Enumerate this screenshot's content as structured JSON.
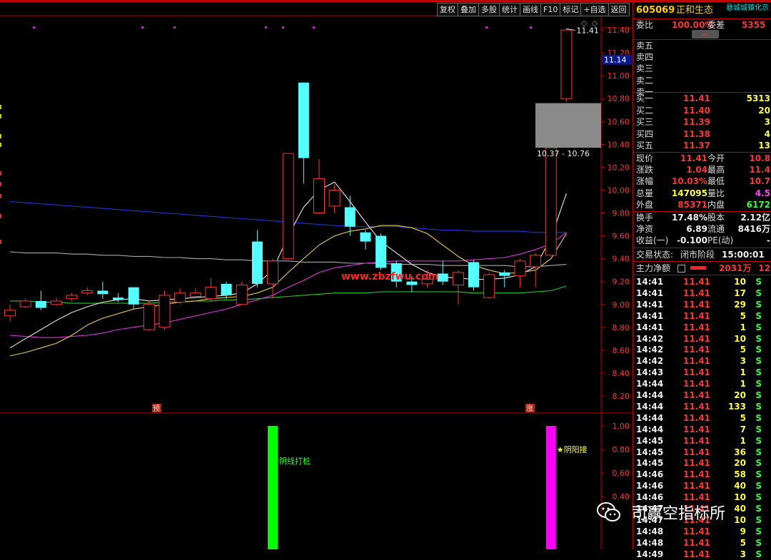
{
  "toolbar": [
    "复权",
    "叠加",
    "多股",
    "统计",
    "画线",
    "F10",
    "标记",
    "+自选",
    "返回"
  ],
  "price_axis": [
    "11.40",
    "11.20",
    "11.00",
    "10.80",
    "10.60",
    "10.40",
    "10.20",
    "10.00",
    "9.80",
    "9.60",
    "9.40",
    "9.20",
    "9.00",
    "8.80",
    "8.60",
    "8.40",
    "8.20"
  ],
  "price_scale_min": 8.2,
  "price_scale_max": 11.4,
  "indicator_axis": [
    "1.00",
    "0.80",
    "0.60",
    "0.40"
  ],
  "current_price_tag": "11.14",
  "chart": {
    "high_label": "11.41",
    "range_label": "10.37 - 10.76",
    "site_watermark": "www.zbzfwu.com",
    "marker_left": "预",
    "marker_right": "涨",
    "signal_green": "阴线打桩",
    "signal_magenta": "★阴阳接"
  },
  "chart_data": {
    "type": "candlestick",
    "candles": [
      {
        "o": 8.9,
        "c": 8.95,
        "h": 9.0,
        "l": 8.85
      },
      {
        "o": 8.98,
        "c": 9.03,
        "h": 9.05,
        "l": 8.97
      },
      {
        "o": 9.03,
        "c": 8.97,
        "h": 9.12,
        "l": 8.95
      },
      {
        "o": 9.0,
        "c": 9.03,
        "h": 9.06,
        "l": 8.99
      },
      {
        "o": 9.05,
        "c": 9.08,
        "h": 9.1,
        "l": 9.03
      },
      {
        "o": 9.1,
        "c": 9.12,
        "h": 9.15,
        "l": 9.08
      },
      {
        "o": 9.12,
        "c": 9.09,
        "h": 9.2,
        "l": 9.05
      },
      {
        "o": 9.06,
        "c": 9.04,
        "h": 9.1,
        "l": 9.02
      },
      {
        "o": 9.15,
        "c": 9.0,
        "h": 9.15,
        "l": 8.96
      },
      {
        "o": 8.78,
        "c": 9.0,
        "h": 9.03,
        "l": 8.77
      },
      {
        "o": 8.8,
        "c": 9.08,
        "h": 9.12,
        "l": 8.78
      },
      {
        "o": 9.02,
        "c": 9.1,
        "h": 9.14,
        "l": 9.0
      },
      {
        "o": 9.07,
        "c": 9.1,
        "h": 9.14,
        "l": 9.05
      },
      {
        "o": 9.05,
        "c": 9.15,
        "h": 9.23,
        "l": 9.03
      },
      {
        "o": 9.18,
        "c": 9.08,
        "h": 9.2,
        "l": 9.05
      },
      {
        "o": 9.0,
        "c": 9.17,
        "h": 9.2,
        "l": 9.0
      },
      {
        "o": 9.55,
        "c": 9.18,
        "h": 9.65,
        "l": 9.15
      },
      {
        "o": 9.18,
        "c": 9.38,
        "h": 9.4,
        "l": 9.05
      },
      {
        "o": 9.4,
        "c": 10.32,
        "h": 10.32,
        "l": 9.4
      },
      {
        "o": 10.94,
        "c": 10.28,
        "h": 10.94,
        "l": 10.06
      },
      {
        "o": 9.8,
        "c": 10.1,
        "h": 10.27,
        "l": 9.79
      },
      {
        "o": 9.86,
        "c": 10.0,
        "h": 10.05,
        "l": 9.8
      },
      {
        "o": 9.85,
        "c": 9.68,
        "h": 9.95,
        "l": 9.6
      },
      {
        "o": 9.63,
        "c": 9.55,
        "h": 9.65,
        "l": 9.48
      },
      {
        "o": 9.6,
        "c": 9.32,
        "h": 9.62,
        "l": 9.3
      },
      {
        "o": 9.36,
        "c": 9.2,
        "h": 9.38,
        "l": 9.15
      },
      {
        "o": 9.2,
        "c": 9.17,
        "h": 9.25,
        "l": 9.11
      },
      {
        "o": 9.18,
        "c": 9.22,
        "h": 9.3,
        "l": 9.15
      },
      {
        "o": 9.27,
        "c": 9.2,
        "h": 9.38,
        "l": 9.17
      },
      {
        "o": 9.17,
        "c": 9.28,
        "h": 9.3,
        "l": 9.0
      },
      {
        "o": 9.37,
        "c": 9.15,
        "h": 9.39,
        "l": 9.12
      },
      {
        "o": 9.06,
        "c": 9.26,
        "h": 9.28,
        "l": 9.05
      },
      {
        "o": 9.28,
        "c": 9.25,
        "h": 9.3,
        "l": 9.15
      },
      {
        "o": 9.25,
        "c": 9.38,
        "h": 9.4,
        "l": 9.15
      },
      {
        "o": 9.33,
        "c": 9.43,
        "h": 9.45,
        "l": 9.15
      },
      {
        "o": 9.43,
        "c": 10.37,
        "h": 10.37,
        "l": 9.43
      },
      {
        "o": 10.8,
        "c": 11.4,
        "h": 11.41,
        "l": 10.77
      }
    ],
    "ma_white": [
      8.62,
      8.7,
      8.78,
      8.86,
      8.93,
      8.98,
      9.02,
      9.04,
      9.05,
      9.03,
      9.04,
      9.05,
      9.06,
      9.07,
      9.08,
      9.1,
      9.18,
      9.3,
      9.6,
      9.85,
      10.0,
      10.07,
      9.9,
      9.72,
      9.55,
      9.45,
      9.35,
      9.28,
      9.24,
      9.23,
      9.22,
      9.22,
      9.23,
      9.26,
      9.33,
      9.58,
      9.97
    ],
    "ma_yellow": [
      8.55,
      8.58,
      8.62,
      8.66,
      8.73,
      8.82,
      8.88,
      8.92,
      8.96,
      8.98,
      9.0,
      9.02,
      9.03,
      9.05,
      9.06,
      9.07,
      9.1,
      9.15,
      9.28,
      9.4,
      9.52,
      9.6,
      9.64,
      9.66,
      9.69,
      9.69,
      9.67,
      9.62,
      9.52,
      9.42,
      9.34,
      9.3,
      9.27,
      9.28,
      9.3,
      9.4,
      9.62
    ],
    "ma_magenta": [
      8.73,
      8.72,
      8.71,
      8.71,
      8.72,
      8.73,
      8.75,
      8.78,
      8.8,
      8.82,
      8.84,
      8.87,
      8.9,
      8.93,
      8.96,
      9.0,
      9.04,
      9.08,
      9.15,
      9.21,
      9.28,
      9.32,
      9.34,
      9.36,
      9.37,
      9.38,
      9.38,
      9.38,
      9.38,
      9.38,
      9.39,
      9.4,
      9.41,
      9.44,
      9.48,
      9.53,
      9.63
    ],
    "ma_green": [
      9.03,
      9.03,
      9.02,
      9.02,
      9.01,
      9.01,
      9.01,
      9.01,
      9.01,
      9.01,
      9.02,
      9.02,
      9.03,
      9.03,
      9.04,
      9.04,
      9.05,
      9.06,
      9.07,
      9.08,
      9.09,
      9.1,
      9.1,
      9.1,
      9.11,
      9.11,
      9.11,
      9.11,
      9.11,
      9.11,
      9.1,
      9.1,
      9.1,
      9.1,
      9.11,
      9.12,
      9.16
    ],
    "ma_blue": [
      9.9,
      9.89,
      9.88,
      9.87,
      9.86,
      9.85,
      9.84,
      9.83,
      9.82,
      9.81,
      9.8,
      9.79,
      9.78,
      9.77,
      9.76,
      9.75,
      9.74,
      9.73,
      9.72,
      9.71,
      9.7,
      9.69,
      9.68,
      9.68,
      9.68,
      9.68,
      9.67,
      9.66,
      9.65,
      9.65,
      9.64,
      9.64,
      9.64,
      9.64,
      9.63,
      9.63,
      9.63
    ],
    "ma_gray": [
      9.46,
      9.45,
      9.45,
      9.45,
      9.44,
      9.44,
      9.43,
      9.43,
      9.42,
      9.42,
      9.41,
      9.41,
      9.4,
      9.4,
      9.39,
      9.39,
      9.38,
      9.38,
      9.38,
      9.37,
      9.37,
      9.37,
      9.36,
      9.36,
      9.36,
      9.35,
      9.35,
      9.35,
      9.34,
      9.34,
      9.34,
      9.34,
      9.34,
      9.33,
      9.33,
      9.34,
      9.35
    ],
    "signals": [
      {
        "index": 17,
        "color": "#00ff00",
        "value": 1.0
      },
      {
        "index": 35,
        "color": "#ff00ff",
        "value": 1.0
      }
    ]
  },
  "quote": {
    "code": "605069",
    "name": "正和生态",
    "ticker_scroll": "悬城城镇化示",
    "weibi_label": "委比",
    "weibi_value": "100.00%",
    "weicha_label": "委差",
    "weicha_value": "5355",
    "sells": [
      {
        "label": "卖五"
      },
      {
        "label": "卖四"
      },
      {
        "label": "卖三"
      },
      {
        "label": "卖二"
      },
      {
        "label": "卖一"
      }
    ],
    "buys": [
      {
        "label": "买一",
        "price": "11.41",
        "vol": "5313"
      },
      {
        "label": "买二",
        "price": "11.40",
        "vol": "20"
      },
      {
        "label": "买三",
        "price": "11.39",
        "vol": "3"
      },
      {
        "label": "买四",
        "price": "11.38",
        "vol": "4"
      },
      {
        "label": "买五",
        "price": "11.37",
        "vol": "13"
      }
    ],
    "stats": [
      {
        "l1": "现价",
        "v1": "11.41",
        "c1": "red",
        "l2": "今开",
        "v2": "10.8",
        "c2": "red"
      },
      {
        "l1": "涨跌",
        "v1": "1.04",
        "c1": "red",
        "l2": "最高",
        "v2": "11.4",
        "c2": "red"
      },
      {
        "l1": "涨幅",
        "v1": "10.03%",
        "c1": "red",
        "l2": "最低",
        "v2": "10.7",
        "c2": "red"
      },
      {
        "l1": "总量",
        "v1": "147095",
        "c1": "yel",
        "l2": "量比",
        "v2": "4.5",
        "c2": "mag"
      },
      {
        "l1": "外盘",
        "v1": "85371",
        "c1": "red",
        "l2": "内盘",
        "v2": "6172",
        "c2": "grn"
      }
    ],
    "stats2": [
      {
        "l1": "换手",
        "v1": "17.48%",
        "l2": "股本",
        "v2": "2.12亿"
      },
      {
        "l1": "净资",
        "v1": "6.89",
        "l2": "流通",
        "v2": "8416万"
      },
      {
        "l1": "收益(一)",
        "v1": "-0.100",
        "l2": "PE(动)",
        "v2": "-"
      }
    ],
    "trade_state_label": "交易状态:",
    "trade_state_value": "闭市阶段",
    "trade_time": "15:00:01",
    "net_label": "主力净额",
    "net_value": "2031万",
    "net_extra": "12"
  },
  "ticks": [
    {
      "t": "14:41",
      "p": "11.41",
      "v": "10",
      "s": "S"
    },
    {
      "t": "14:41",
      "p": "11.41",
      "v": "17",
      "s": "S"
    },
    {
      "t": "14:41",
      "p": "11.41",
      "v": "29",
      "s": "S"
    },
    {
      "t": "14:41",
      "p": "11.41",
      "v": "5",
      "s": "S"
    },
    {
      "t": "14:41",
      "p": "11.41",
      "v": "1",
      "s": "S"
    },
    {
      "t": "14:42",
      "p": "11.41",
      "v": "10",
      "s": "S"
    },
    {
      "t": "14:42",
      "p": "11.41",
      "v": "5",
      "s": "S"
    },
    {
      "t": "14:42",
      "p": "11.41",
      "v": "3",
      "s": "S"
    },
    {
      "t": "14:43",
      "p": "11.41",
      "v": "1",
      "s": "S"
    },
    {
      "t": "14:44",
      "p": "11.41",
      "v": "1",
      "s": "S"
    },
    {
      "t": "14:44",
      "p": "11.41",
      "v": "20",
      "s": "S"
    },
    {
      "t": "14:44",
      "p": "11.41",
      "v": "133",
      "s": "S"
    },
    {
      "t": "14:44",
      "p": "11.41",
      "v": "5",
      "s": "S"
    },
    {
      "t": "14:44",
      "p": "11.41",
      "v": "7",
      "s": "S"
    },
    {
      "t": "14:45",
      "p": "11.41",
      "v": "1",
      "s": "S"
    },
    {
      "t": "14:45",
      "p": "11.41",
      "v": "36",
      "s": "S"
    },
    {
      "t": "14:45",
      "p": "11.41",
      "v": "20",
      "s": "S"
    },
    {
      "t": "14:46",
      "p": "11.41",
      "v": "58",
      "s": "S"
    },
    {
      "t": "14:46",
      "p": "11.41",
      "v": "40",
      "s": "S"
    },
    {
      "t": "14:46",
      "p": "11.41",
      "v": "10",
      "s": "S"
    },
    {
      "t": "14:47",
      "p": "11.41",
      "v": "40",
      "s": "S"
    },
    {
      "t": "14:47",
      "p": "11.41",
      "v": "10",
      "s": "S"
    },
    {
      "t": "14:48",
      "p": "11.41",
      "v": "9",
      "s": "S"
    },
    {
      "t": "14:48",
      "p": "11.41",
      "v": "5",
      "s": "S"
    },
    {
      "t": "14:49",
      "p": "11.41",
      "v": "3",
      "s": "S"
    }
  ],
  "watermark": "司赢空指标所"
}
